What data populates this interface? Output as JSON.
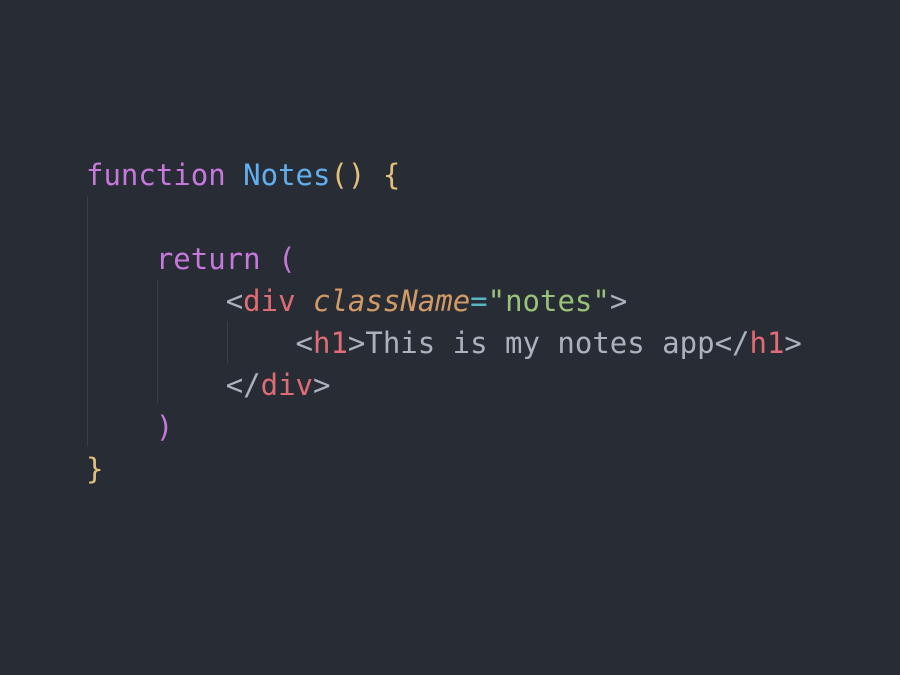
{
  "editor": {
    "theme_colors": {
      "background": "#282c34",
      "keyword": "#c678dd",
      "function_name": "#61afef",
      "bracket": "#e5c07b",
      "tag": "#e06c75",
      "attribute": "#d19a66",
      "string": "#98c379",
      "operator": "#56b6c2",
      "plain": "#abb2bf"
    },
    "lines": [
      {
        "tokens": [
          {
            "t": "function",
            "c": "kw"
          },
          {
            "t": " ",
            "c": "text"
          },
          {
            "t": "Notes",
            "c": "fn"
          },
          {
            "t": "()",
            "c": "paren-y"
          },
          {
            "t": " ",
            "c": "text"
          },
          {
            "t": "{",
            "c": "brace-y"
          }
        ]
      },
      {
        "tokens": []
      },
      {
        "tokens": [
          {
            "t": "    ",
            "c": "text"
          },
          {
            "t": "return",
            "c": "kw"
          },
          {
            "t": " ",
            "c": "text"
          },
          {
            "t": "(",
            "c": "paren-p"
          }
        ]
      },
      {
        "tokens": [
          {
            "t": "        ",
            "c": "text"
          },
          {
            "t": "<",
            "c": "punct"
          },
          {
            "t": "div",
            "c": "tag"
          },
          {
            "t": " ",
            "c": "text"
          },
          {
            "t": "className",
            "c": "attr"
          },
          {
            "t": "=",
            "c": "op"
          },
          {
            "t": "\"notes\"",
            "c": "str"
          },
          {
            "t": ">",
            "c": "punct"
          }
        ]
      },
      {
        "tokens": [
          {
            "t": "            ",
            "c": "text"
          },
          {
            "t": "<",
            "c": "punct"
          },
          {
            "t": "h1",
            "c": "tag"
          },
          {
            "t": ">",
            "c": "punct"
          },
          {
            "t": "This is my notes app",
            "c": "text"
          },
          {
            "t": "</",
            "c": "punct"
          },
          {
            "t": "h1",
            "c": "tag"
          },
          {
            "t": ">",
            "c": "punct"
          }
        ]
      },
      {
        "tokens": [
          {
            "t": "        ",
            "c": "text"
          },
          {
            "t": "</",
            "c": "punct"
          },
          {
            "t": "div",
            "c": "tag"
          },
          {
            "t": ">",
            "c": "punct"
          }
        ]
      },
      {
        "tokens": [
          {
            "t": "    ",
            "c": "text"
          },
          {
            "t": ")",
            "c": "paren-p"
          }
        ]
      },
      {
        "tokens": [
          {
            "t": "}",
            "c": "brace-y"
          }
        ]
      }
    ]
  }
}
